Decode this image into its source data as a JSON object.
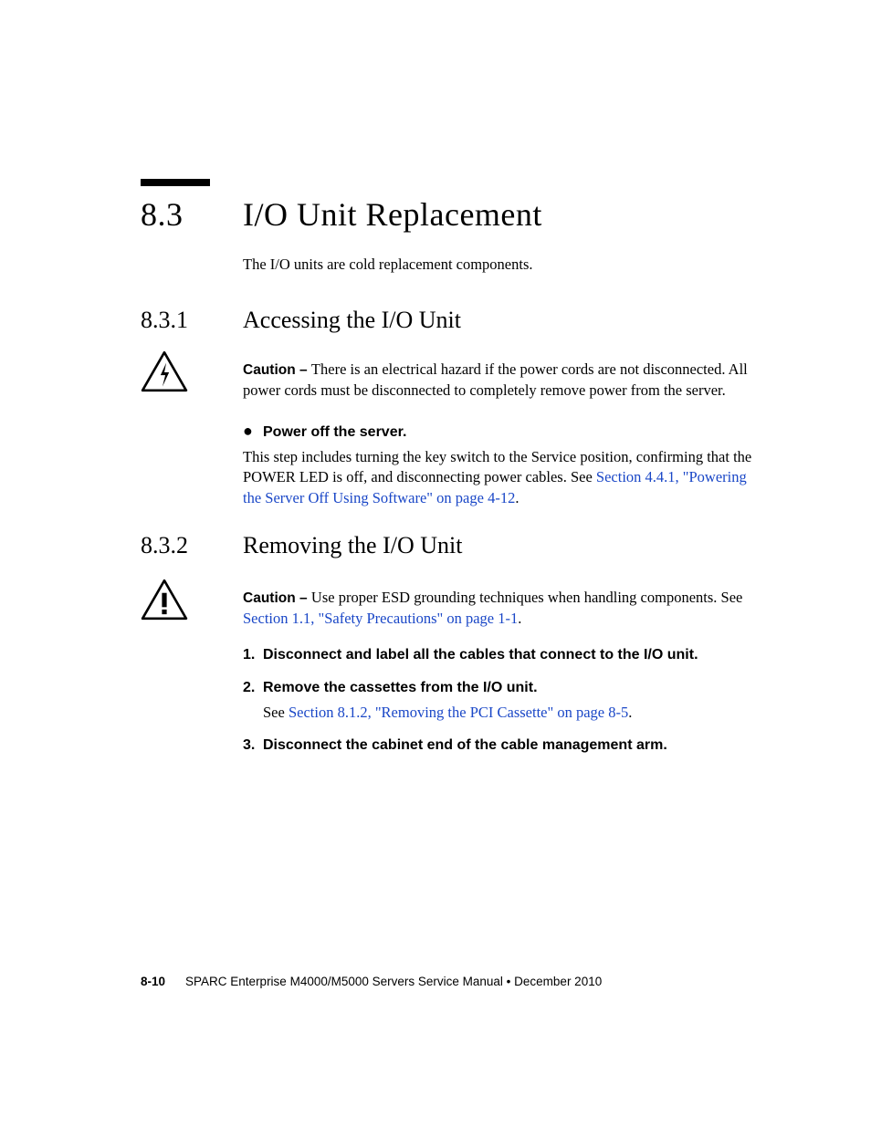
{
  "section": {
    "number": "8.3",
    "title": "I/O Unit Replacement",
    "intro": "The I/O units are cold replacement components."
  },
  "sub1": {
    "number": "8.3.1",
    "title": "Accessing the I/O Unit",
    "caution_label": "Caution – ",
    "caution_text": "There is an electrical hazard if the power cords are not disconnected. All power cords must be disconnected to completely remove power from the server.",
    "step_bullet": "●",
    "step_text": "Power off the server.",
    "para_before_link": "This step includes turning the key switch to the Service position, confirming that the POWER LED is off, and disconnecting power cables. See ",
    "para_link": "Section 4.4.1, \"Powering the Server Off Using Software\" on page 4-12",
    "para_after_link": "."
  },
  "sub2": {
    "number": "8.3.2",
    "title": "Removing the I/O Unit",
    "caution_label": "Caution – ",
    "caution_text_before_link": "Use proper ESD grounding techniques when handling components. See ",
    "caution_link": "Section 1.1, \"Safety Precautions\" on page 1-1",
    "caution_text_after_link": ".",
    "steps": {
      "s1_num": "1.",
      "s1_text": "Disconnect and label all the cables that connect to the I/O unit.",
      "s2_num": "2.",
      "s2_text": "Remove the cassettes from the I/O unit.",
      "s2_sub_before": "See ",
      "s2_sub_link": "Section 8.1.2, \"Removing the PCI Cassette\" on page 8-5",
      "s2_sub_after": ".",
      "s3_num": "3.",
      "s3_text": "Disconnect the cabinet end of the cable management arm."
    }
  },
  "footer": {
    "page_num": "8-10",
    "text": "SPARC Enterprise M4000/M5000 Servers Service Manual  •  December 2010"
  }
}
